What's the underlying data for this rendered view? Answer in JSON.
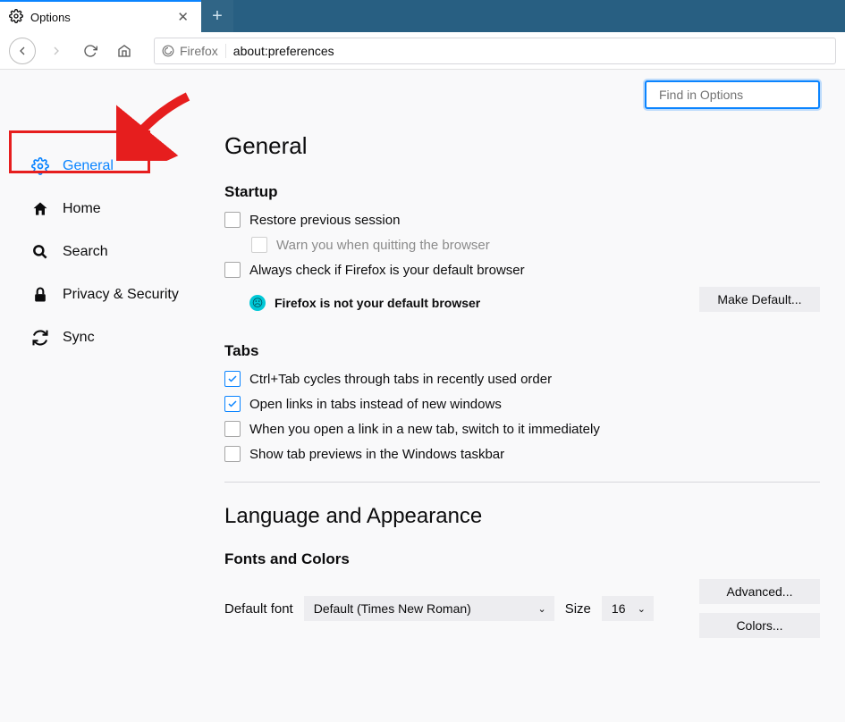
{
  "tab": {
    "title": "Options"
  },
  "urlbar": {
    "identity": "Firefox",
    "address": "about:preferences"
  },
  "search": {
    "placeholder": "Find in Options"
  },
  "sidebar": {
    "items": [
      {
        "label": "General"
      },
      {
        "label": "Home"
      },
      {
        "label": "Search"
      },
      {
        "label": "Privacy & Security"
      },
      {
        "label": "Sync"
      }
    ]
  },
  "page": {
    "title": "General",
    "startup": {
      "heading": "Startup",
      "restore": "Restore previous session",
      "warn_quit": "Warn you when quitting the browser",
      "always_check": "Always check if Firefox is your default browser",
      "not_default": "Firefox is not your default browser",
      "make_default": "Make Default..."
    },
    "tabs": {
      "heading": "Tabs",
      "ctrl_tab": "Ctrl+Tab cycles through tabs in recently used order",
      "open_links": "Open links in tabs instead of new windows",
      "switch_immediately": "When you open a link in a new tab, switch to it immediately",
      "previews": "Show tab previews in the Windows taskbar"
    },
    "lang": {
      "heading": "Language and Appearance",
      "fonts_colors": "Fonts and Colors",
      "default_font_label": "Default font",
      "default_font_value": "Default (Times New Roman)",
      "size_label": "Size",
      "size_value": "16",
      "advanced": "Advanced...",
      "colors": "Colors..."
    }
  }
}
